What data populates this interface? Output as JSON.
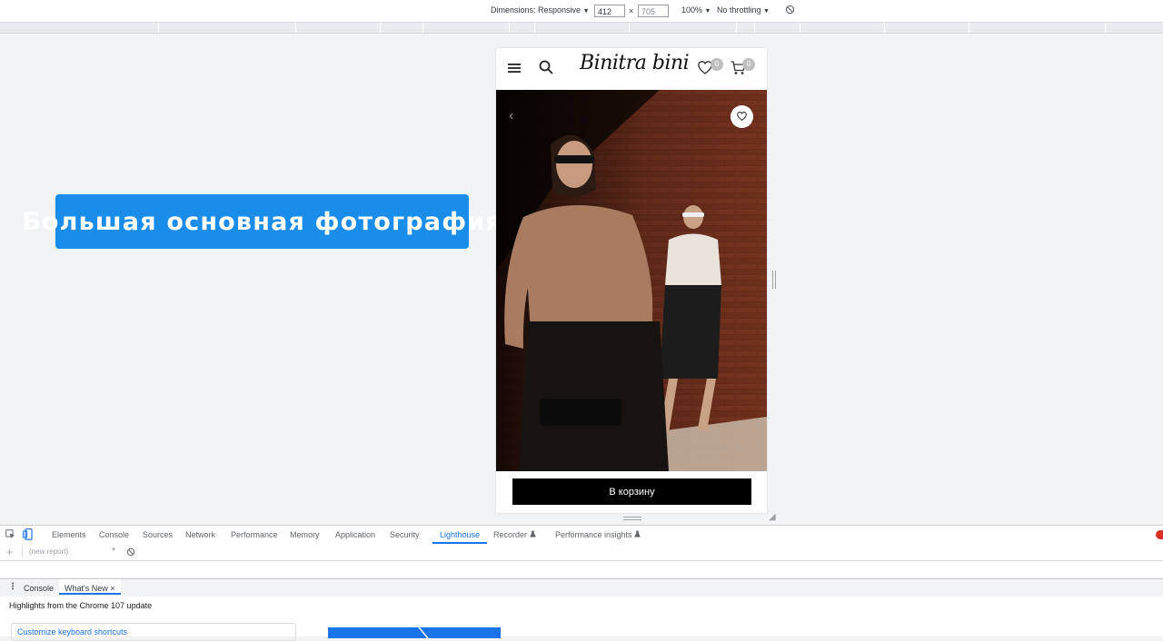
{
  "device_toolbar": {
    "dimensions_label": "Dimensions: Responsive",
    "width_value": "412",
    "times_sign": "×",
    "height_value": "705",
    "zoom": "100%",
    "throttling": "No throttling",
    "dropdown_glyph": "▼",
    "rotate_icon": "rotate-icon"
  },
  "callout": {
    "text": "Большая основная фотография"
  },
  "site": {
    "logo_text": "Binitra bini",
    "wishlist_count": "0",
    "cart_count": "0",
    "cart_button_label": "В корзину"
  },
  "devtools": {
    "tabs": [
      "Elements",
      "Console",
      "Sources",
      "Network",
      "Performance",
      "Memory",
      "Application",
      "Security",
      "Lighthouse",
      "Recorder",
      "Performance insights"
    ],
    "active_tab": "Lighthouse",
    "report_placeholder": "(new report)",
    "add_glyph": "+",
    "drawer_tabs": [
      "Console",
      "What's New"
    ],
    "drawer_close_glyph": "×",
    "highlights_text": "Highlights from the Chrome 107 update",
    "customize_link": "Customize keyboard shortcuts"
  },
  "colors": {
    "callout_bg": "#1a8cea",
    "active_tab": "#1a73e8",
    "cart_button_bg": "#000000"
  }
}
